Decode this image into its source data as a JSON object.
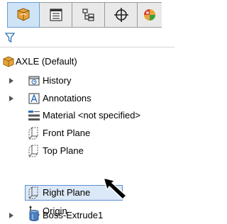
{
  "tabs": [
    {
      "name": "feature-manager",
      "icon": "part-icon",
      "active": true
    },
    {
      "name": "property-manager",
      "icon": "property-list-icon",
      "active": false
    },
    {
      "name": "configuration-manager",
      "icon": "configuration-icon",
      "active": false
    },
    {
      "name": "dimxpert-manager",
      "icon": "dimxpert-crosshair-icon",
      "active": false
    },
    {
      "name": "display-manager",
      "icon": "appearance-sphere-icon",
      "active": false
    }
  ],
  "filter": {
    "icon": "filter-funnel-icon"
  },
  "tree": {
    "root": {
      "label": "AXLE  (Default)",
      "icon": "part-icon"
    },
    "items": [
      {
        "label": "History",
        "icon": "history-folder-icon",
        "expandable": true
      },
      {
        "label": "Annotations",
        "icon": "annotations-icon",
        "expandable": true
      },
      {
        "label": "Material <not specified>",
        "icon": "material-icon",
        "expandable": false
      },
      {
        "label": "Front Plane",
        "icon": "plane-icon",
        "expandable": false
      },
      {
        "label": "Top Plane",
        "icon": "plane-icon",
        "expandable": false
      },
      {
        "label": "Right Plane",
        "icon": "plane-icon",
        "expandable": false,
        "selected": true
      },
      {
        "label": "Origin",
        "icon": "origin-icon",
        "expandable": false
      },
      {
        "label": "Boss-Extrude1",
        "icon": "extrude-feature-icon",
        "expandable": true
      }
    ]
  },
  "cursor": {
    "icon": "mouse-pointer-arrow-icon"
  },
  "colors": {
    "selection_fill": "#dbe8f7",
    "selection_border": "#5b8fd0",
    "part_orange": "#e8a33a",
    "icon_blue": "#2e6fb7",
    "plane_yellow": "#c8a040"
  }
}
